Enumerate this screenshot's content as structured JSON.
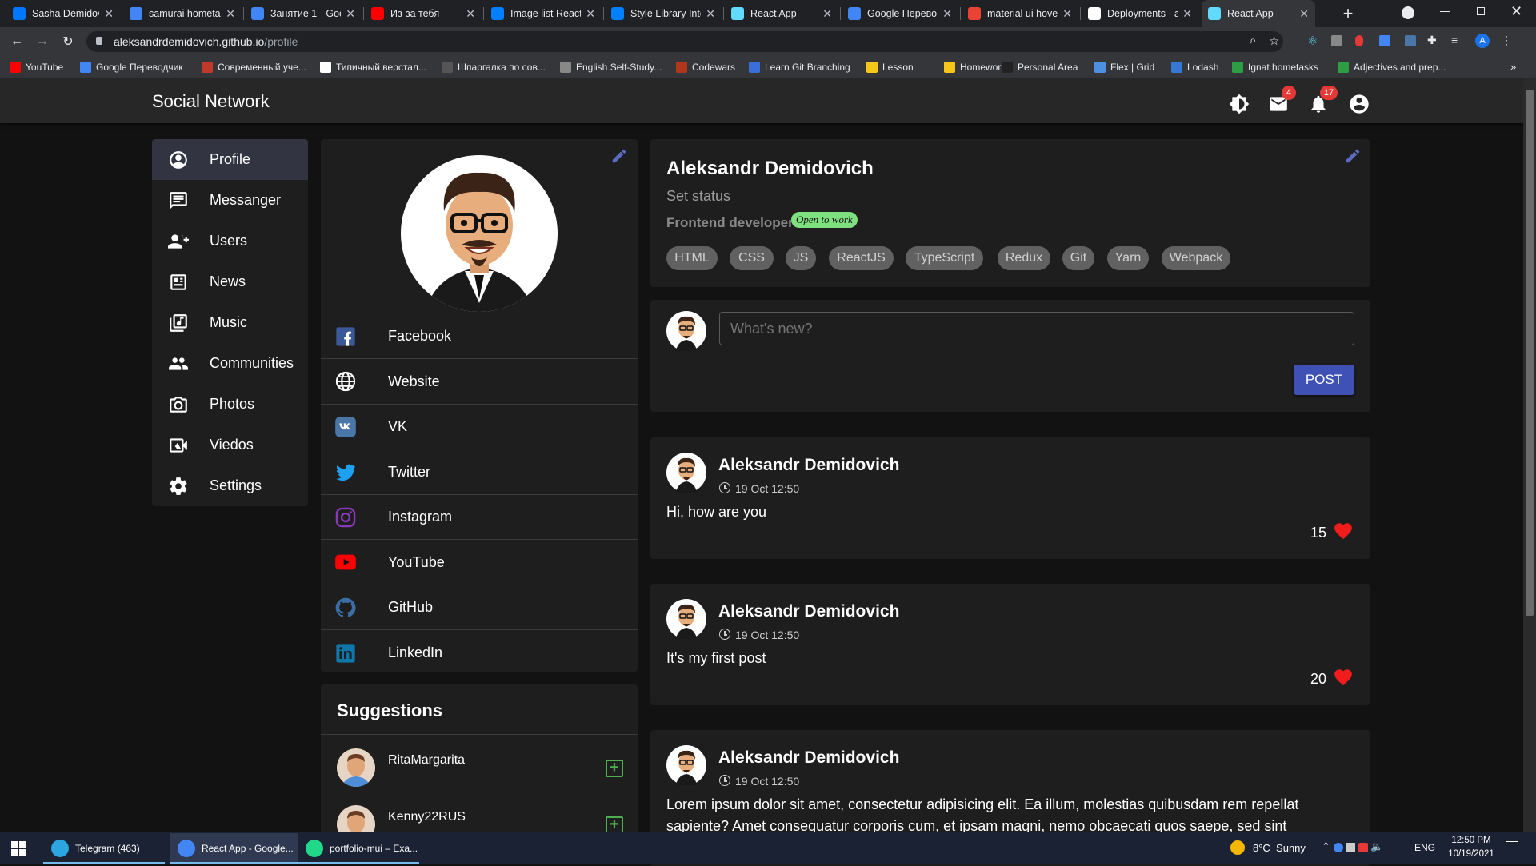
{
  "browser": {
    "tabs": [
      {
        "title": "Sasha Demidovi",
        "icon": "vk-icon",
        "color": "#0077ff"
      },
      {
        "title": "samurai hometa",
        "icon": "docs-icon",
        "color": "#4285f4"
      },
      {
        "title": "Занятие 1 - Goo",
        "icon": "docs-icon",
        "color": "#4285f4"
      },
      {
        "title": "Из-за тебя",
        "icon": "youtube-icon",
        "color": "#ff0000"
      },
      {
        "title": "Image list React",
        "icon": "mui-icon",
        "color": "#007fff"
      },
      {
        "title": "Style Library Inte",
        "icon": "mui-icon",
        "color": "#007fff"
      },
      {
        "title": "React App",
        "icon": "react-icon",
        "color": "#61dafb"
      },
      {
        "title": "Google Перево",
        "icon": "translate-icon",
        "color": "#4285f4"
      },
      {
        "title": "material ui hove",
        "icon": "google-icon",
        "color": "#ea4335"
      },
      {
        "title": "Deployments · a",
        "icon": "github-icon",
        "color": "#ffffff"
      },
      {
        "title": "React App",
        "icon": "react-icon",
        "color": "#61dafb"
      }
    ],
    "url_host": "aleksandrdemidovich.github.io",
    "url_path": "/profile",
    "bookmarks": [
      "YouTube",
      "Google Переводчик",
      "Современный уче...",
      "Типичный верстал...",
      "Шпаргалка по сов...",
      "English Self-Study...",
      "Codewars",
      "Learn Git Branching",
      "Lesson",
      "Homework",
      "Personal Area",
      "Flex | Grid",
      "Lodash",
      "Ignat hometasks",
      "Adjectives and prep..."
    ],
    "bookmark_colors": [
      "#ff0000",
      "#4285f4",
      "#c0392b",
      "#ffffff",
      "#555555",
      "#888888",
      "#b1361e",
      "#3a6fd8",
      "#f5c518",
      "#f5c518",
      "#222222",
      "#4d8fe0",
      "#3777d6",
      "#2e9e44",
      "#2e9e44"
    ]
  },
  "app": {
    "title": "Social Network",
    "mail_badge": "4",
    "notif_badge": "17"
  },
  "nav": [
    {
      "label": "Profile",
      "icon": "account-circle-icon"
    },
    {
      "label": "Messanger",
      "icon": "message-icon"
    },
    {
      "label": "Users",
      "icon": "group-add-icon"
    },
    {
      "label": "News",
      "icon": "newspaper-icon"
    },
    {
      "label": "Music",
      "icon": "library-music-icon"
    },
    {
      "label": "Communities",
      "icon": "people-icon"
    },
    {
      "label": "Photos",
      "icon": "camera-icon"
    },
    {
      "label": "Viedos",
      "icon": "video-camera-icon"
    },
    {
      "label": "Settings",
      "icon": "settings-icon"
    }
  ],
  "social_links": [
    {
      "label": "Facebook",
      "icon": "facebook-icon",
      "color": "#3b5998"
    },
    {
      "label": "Website",
      "icon": "globe-icon",
      "color": "#ffffff"
    },
    {
      "label": "VK",
      "icon": "vk-icon",
      "color": "#4a76a8"
    },
    {
      "label": "Twitter",
      "icon": "twitter-icon",
      "color": "#1da1f2"
    },
    {
      "label": "Instagram",
      "icon": "instagram-icon",
      "color": "#8a3ab9"
    },
    {
      "label": "YouTube",
      "icon": "youtube-icon",
      "color": "#ff0000"
    },
    {
      "label": "GitHub",
      "icon": "github-icon",
      "color": "#3b6ea5"
    },
    {
      "label": "LinkedIn",
      "icon": "linkedin-icon",
      "color": "#0e76a8"
    }
  ],
  "suggestions": {
    "title": "Suggestions",
    "users": [
      "RitaMargarita",
      "Kenny22RUS"
    ]
  },
  "profile": {
    "name": "Aleksandr Demidovich",
    "status": "Set status",
    "position": "Frontend developer",
    "badge": "Open to work",
    "skills": [
      "HTML",
      "CSS",
      "JS",
      "ReactJS",
      "TypeScript",
      "Redux",
      "Git",
      "Yarn",
      "Webpack"
    ]
  },
  "composer": {
    "placeholder": "What's new?",
    "post_label": "POST"
  },
  "posts": [
    {
      "author": "Aleksandr Demidovich",
      "date": "19 Oct 12:50",
      "text": "Hi, how are you",
      "likes": "15"
    },
    {
      "author": "Aleksandr Demidovich",
      "date": "19 Oct 12:50",
      "text": "It's my first post",
      "likes": "20"
    },
    {
      "author": "Aleksandr Demidovich",
      "date": "19 Oct 12:50",
      "text": "Lorem ipsum dolor sit amet, consectetur adipisicing elit. Ea illum, molestias quibusdam rem repellat sapiente? Amet consequatur corporis cum, et ipsam magni, nemo obcaecati quos saepe, sed sint"
    }
  ],
  "taskbar": {
    "apps": [
      {
        "label": "Telegram (463)",
        "icon": "telegram-icon",
        "color": "#2ca5e0"
      },
      {
        "label": "React App - Google...",
        "icon": "chrome-icon",
        "color": "#4285f4"
      },
      {
        "label": "portfolio-mui – Exa...",
        "icon": "webstorm-icon",
        "color": "#21d789"
      }
    ],
    "weather": "8°C  Sunny",
    "lang": "ENG",
    "time": "12:50 PM",
    "date": "10/19/2021"
  }
}
